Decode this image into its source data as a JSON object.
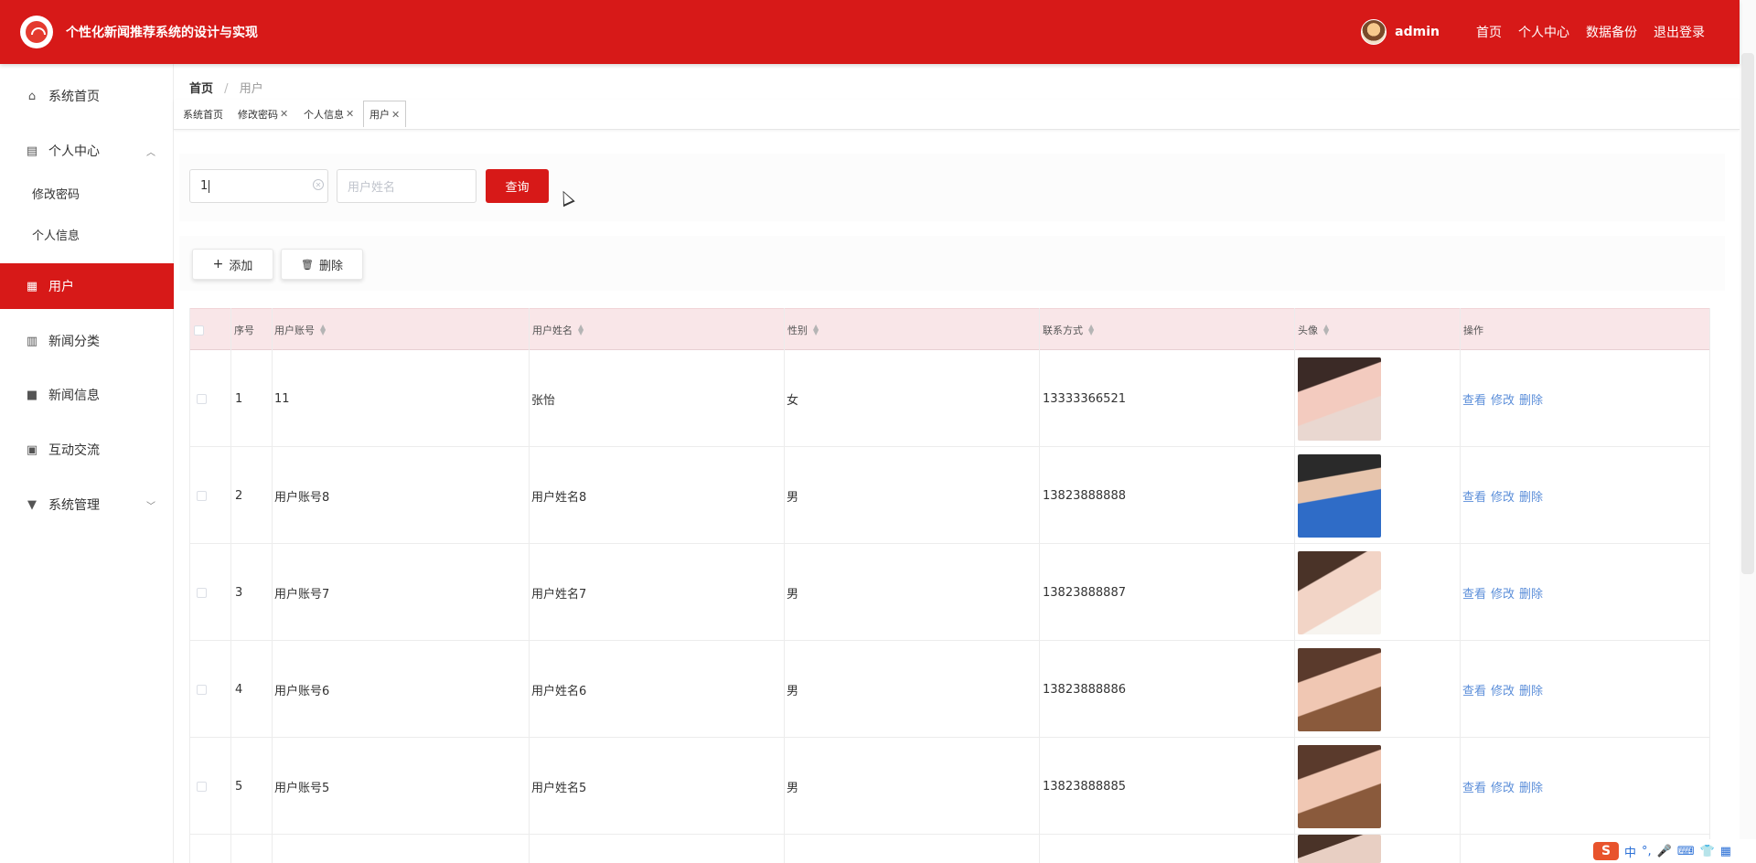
{
  "header": {
    "title": "个性化新闻推荐系统的设计与实现",
    "username": "admin",
    "nav": [
      "首页",
      "个人中心",
      "数据备份",
      "退出登录"
    ]
  },
  "sidebar": {
    "items": [
      {
        "label": "系统首页",
        "icon": "home-icon"
      },
      {
        "label": "个人中心",
        "icon": "profile-card-icon"
      },
      {
        "label": "修改密码"
      },
      {
        "label": "个人信息"
      },
      {
        "label": "用户",
        "icon": "grid-icon"
      },
      {
        "label": "新闻分类",
        "icon": "chart-icon"
      },
      {
        "label": "新闻信息",
        "icon": "briefcase-icon"
      },
      {
        "label": "互动交流",
        "icon": "clipboard-icon"
      },
      {
        "label": "系统管理",
        "icon": "monitor-icon"
      }
    ]
  },
  "breadcrumb": {
    "home": "首页",
    "current": "用户"
  },
  "tags": [
    {
      "label": "系统首页"
    },
    {
      "label": "修改密码"
    },
    {
      "label": "个人信息"
    },
    {
      "label": "用户"
    }
  ],
  "search": {
    "account_value": "1",
    "name_placeholder": "用户姓名",
    "query_label": "查询"
  },
  "actions": {
    "add_label": "添加",
    "delete_label": "删除"
  },
  "table": {
    "headers": [
      "序号",
      "用户账号",
      "用户姓名",
      "性别",
      "联系方式",
      "头像",
      "操作"
    ],
    "operations": [
      "查看",
      "修改",
      "删除"
    ],
    "rows": [
      {
        "index": "1",
        "account": "11",
        "name": "张怡",
        "gender": "女",
        "phone": "13333366521"
      },
      {
        "index": "2",
        "account": "用户账号8",
        "name": "用户姓名8",
        "gender": "男",
        "phone": "13823888888"
      },
      {
        "index": "3",
        "account": "用户账号7",
        "name": "用户姓名7",
        "gender": "男",
        "phone": "13823888887"
      },
      {
        "index": "4",
        "account": "用户账号6",
        "name": "用户姓名6",
        "gender": "男",
        "phone": "13823888886"
      },
      {
        "index": "5",
        "account": "用户账号5",
        "name": "用户姓名5",
        "gender": "男",
        "phone": "13823888885"
      }
    ]
  },
  "colors": {
    "brand": "#d71918",
    "link": "#5b8ed9",
    "header_row": "#f9e6e8"
  },
  "tray": {
    "lang": "中"
  }
}
